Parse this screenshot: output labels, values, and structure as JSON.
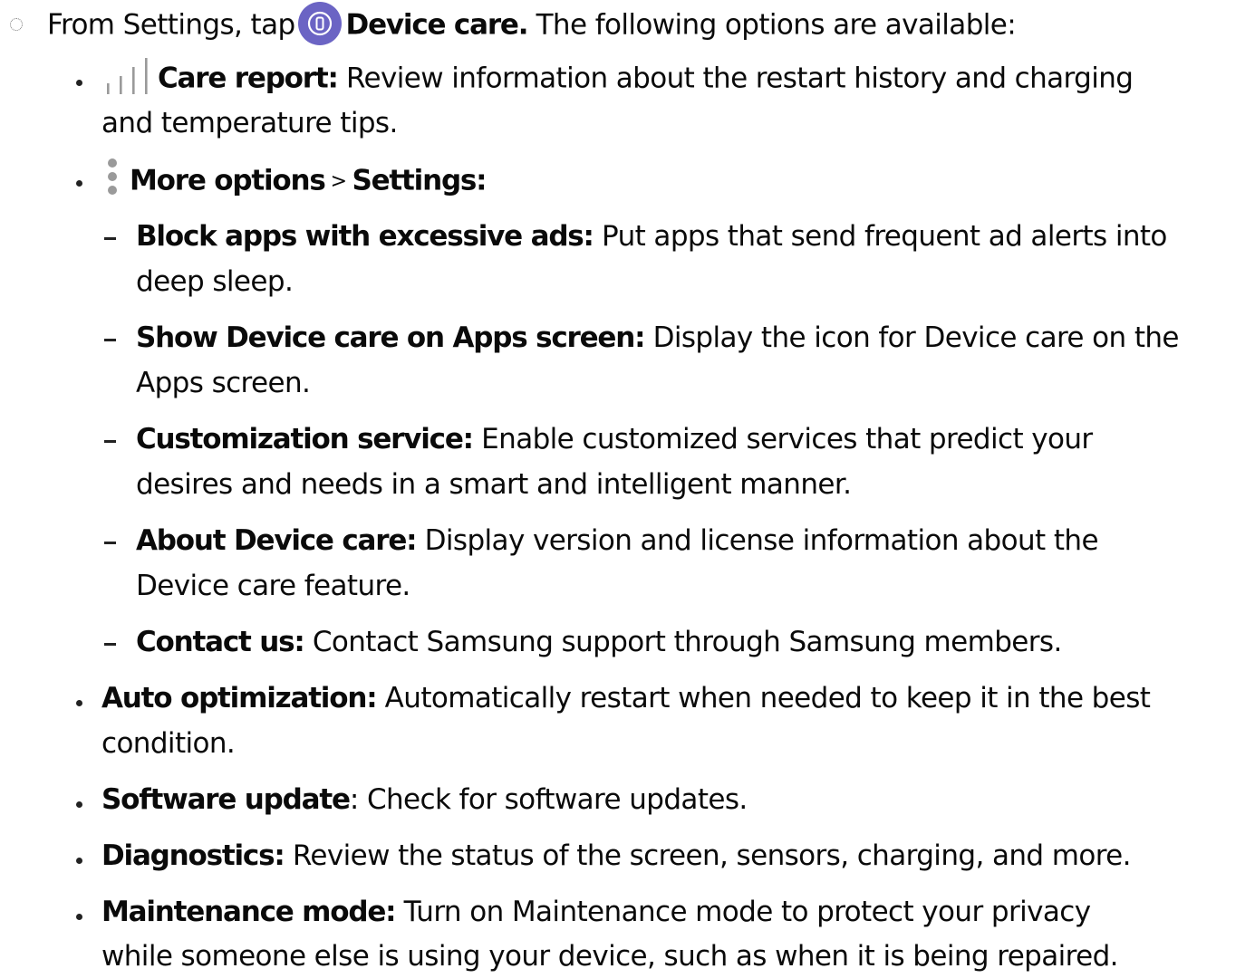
{
  "intro": {
    "prefix": "From Settings, tap",
    "app": "Device care.",
    "suffix": "The following options are available:"
  },
  "care_report": {
    "title": "Care report:",
    "desc_line1": "Review information about the restart history and charging",
    "desc_line2": "and temperature tips."
  },
  "more_options": {
    "title": "More options",
    "separator": ">",
    "settings": "Settings:"
  },
  "sub_items": [
    {
      "title": "Block apps with excessive ads:",
      "line1": "Put apps that send frequent ad alerts into",
      "line2": "deep sleep."
    },
    {
      "title": "Show Device care on Apps screen:",
      "line1": "Display the icon for Device care on the",
      "line2": "Apps screen."
    },
    {
      "title": "Customization service:",
      "line1": "Enable customized services that predict your",
      "line2": "desires and needs in a smart and intelligent manner."
    },
    {
      "title": "About Device care:",
      "line1": "Display version and license information about the",
      "line2": "Device care feature."
    },
    {
      "title": "Contact us:",
      "line1": "Contact Samsung support through Samsung members.",
      "line2": ""
    }
  ],
  "items": [
    {
      "title": "Auto optimization:",
      "line1": "Automatically restart when needed to keep it in the best",
      "line2": "condition."
    },
    {
      "title": "Software update",
      "colon": ":",
      "line1": "Check for software updates.",
      "line2": ""
    },
    {
      "title": "Diagnostics:",
      "line1": "Review the status of the screen, sensors, charging, and more.",
      "line2": ""
    },
    {
      "title": "Maintenance mode:",
      "line1": "Turn on Maintenance mode to protect your privacy",
      "line2": "while someone else is using your device, such as when it is being repaired."
    }
  ],
  "icons": {
    "device_care": "device-care-icon",
    "care_report": "bar-chart-icon",
    "more_options": "more-options-icon",
    "step": "step-circle-icon"
  },
  "colors": {
    "device_care_icon": "#6b64c4",
    "text": "#0a0a0a",
    "icon_gray": "#9a9a9a"
  }
}
